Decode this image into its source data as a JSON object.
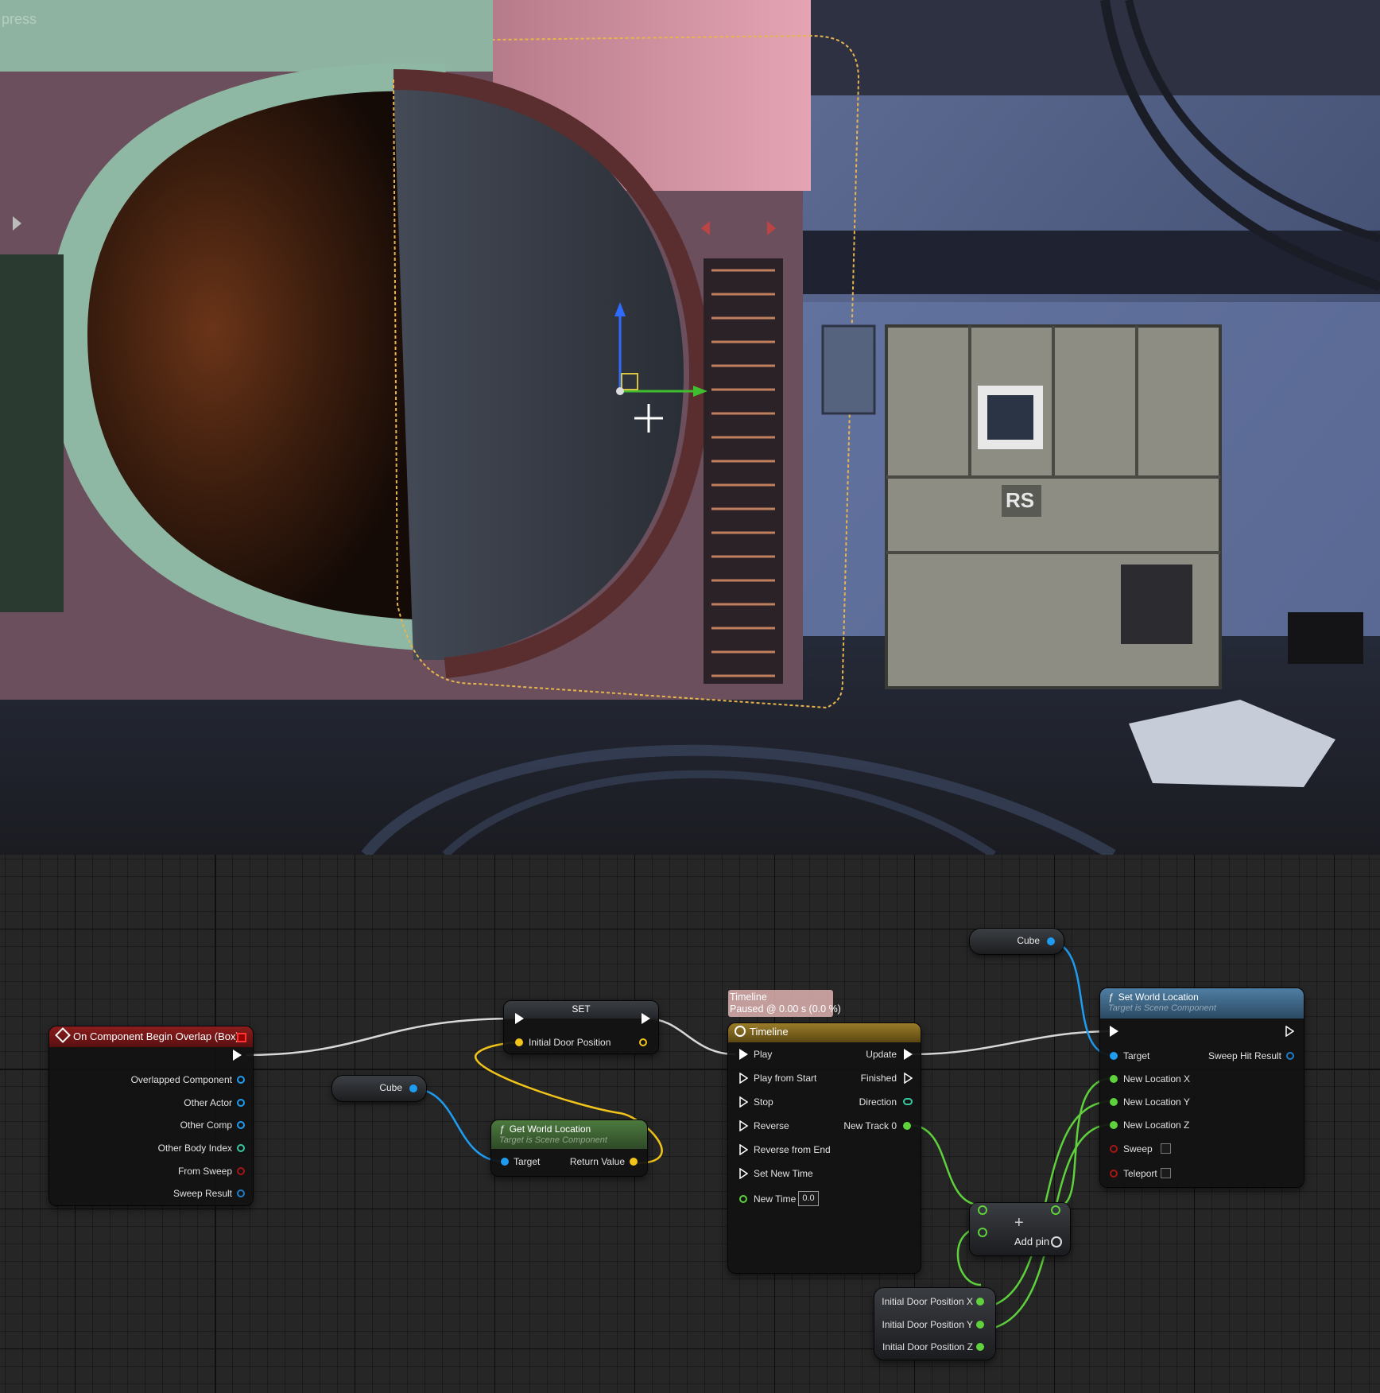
{
  "viewport": {
    "corner_text": "press",
    "panel_label": "RS"
  },
  "graph": {
    "event_node": {
      "title": "On Component Begin Overlap (Box)",
      "pins": [
        "Overlapped Component",
        "Other Actor",
        "Other Comp",
        "Other Body Index",
        "From Sweep",
        "Sweep Result"
      ]
    },
    "cube_var_1": {
      "label": "Cube"
    },
    "cube_var_2": {
      "label": "Cube"
    },
    "set_node": {
      "title": "SET",
      "pin": "Initial Door Position"
    },
    "get_world_location": {
      "title": "Get World Location",
      "subtitle": "Target is Scene Component",
      "target": "Target",
      "return": "Return Value"
    },
    "timeline_comment": {
      "line1": "Timeline",
      "line2": "Paused @ 0.00 s (0.0 %)"
    },
    "timeline_node": {
      "title": "Timeline",
      "inputs": [
        "Play",
        "Play from Start",
        "Stop",
        "Reverse",
        "Reverse from End",
        "Set New Time",
        "New Time"
      ],
      "outputs": [
        "Update",
        "Finished",
        "Direction",
        "New Track 0"
      ],
      "new_time_value": "0.0"
    },
    "set_world_location": {
      "title": "Set World Location",
      "subtitle": "Target is Scene Component",
      "pins": [
        "Target",
        "New Location X",
        "New Location Y",
        "New Location Z",
        "Sweep",
        "Teleport"
      ],
      "output": "Sweep Hit Result"
    },
    "add_node": {
      "symbol": "+",
      "add_pin": "Add pin"
    },
    "break_node": {
      "pins": [
        "Initial Door Position X",
        "Initial Door Position Y",
        "Initial Door Position Z"
      ]
    }
  },
  "colors": {
    "exec": "#ffffff",
    "object": "#1f9cf0",
    "vector": "#f0c41b",
    "float": "#5ed13c",
    "bool": "#a51616",
    "struct": "#1f7cc8",
    "int": "#38c8a0"
  }
}
